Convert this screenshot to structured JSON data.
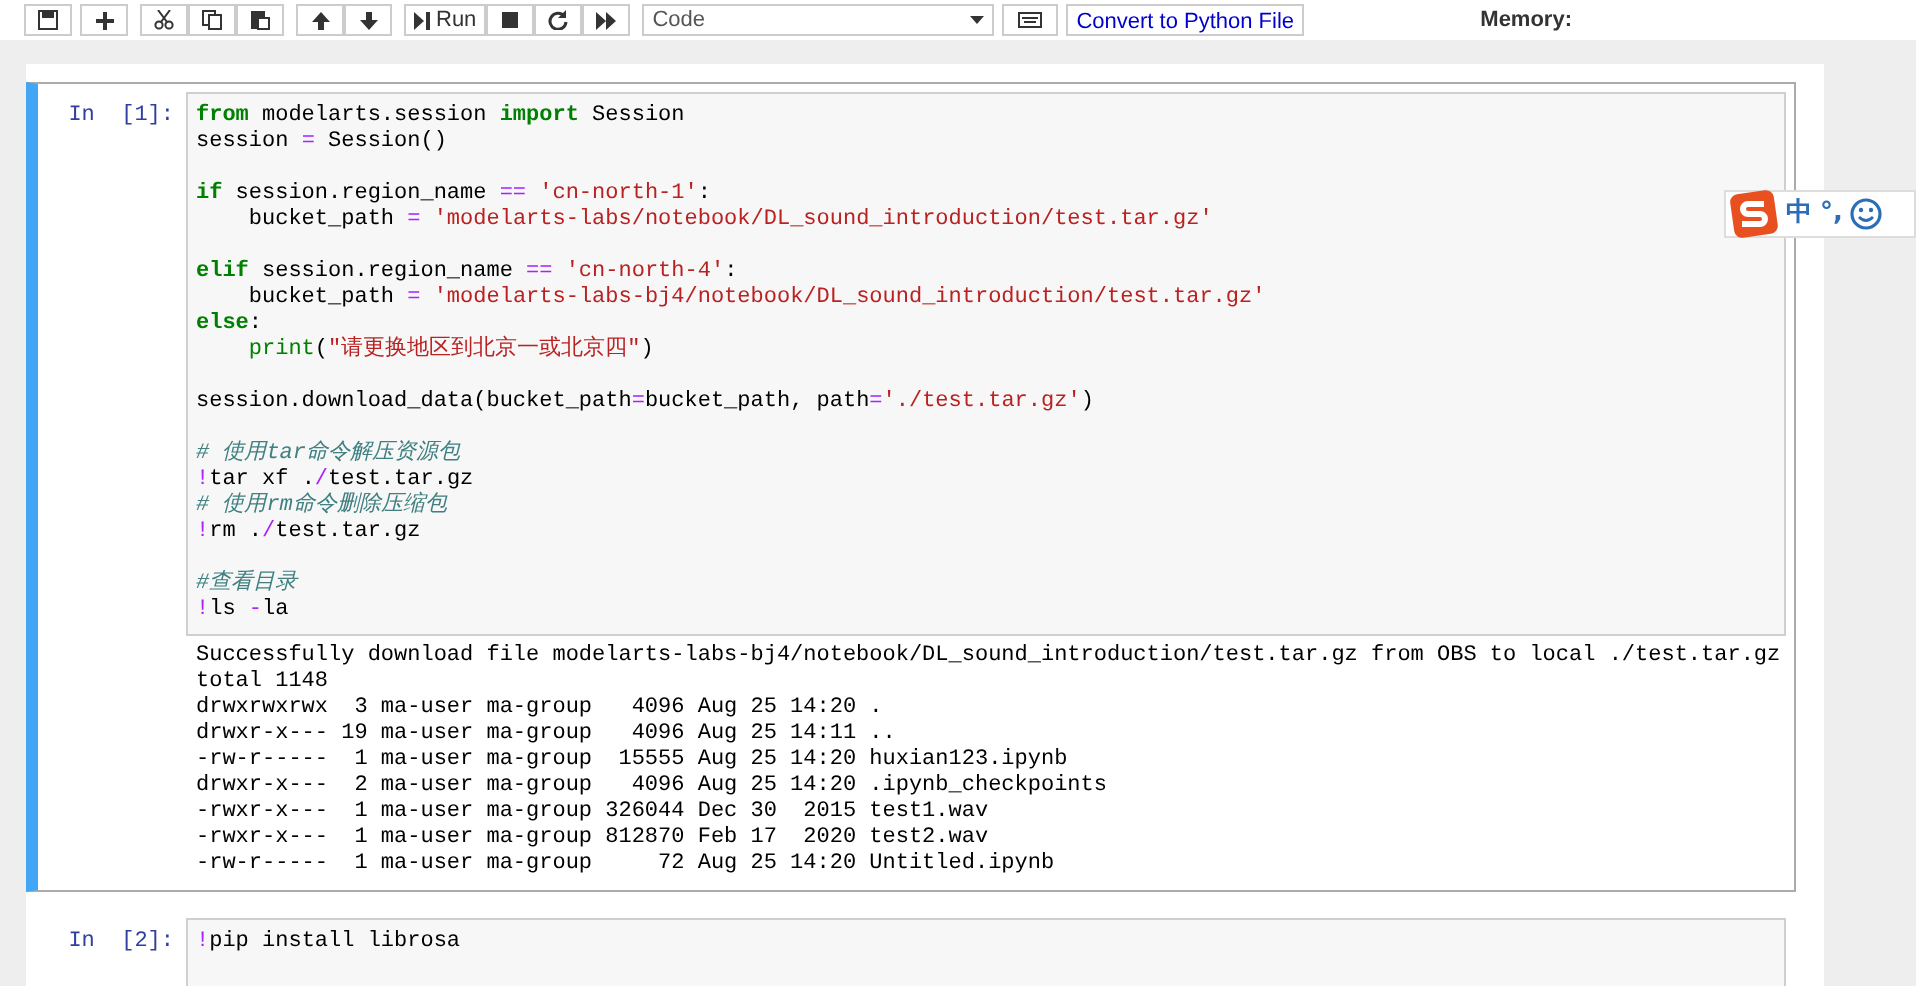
{
  "toolbar": {
    "run_label": "Run",
    "cell_type": "Code",
    "convert_label": "Convert to Python File",
    "memory_label": "Memory:"
  },
  "cells": [
    {
      "prompt": "In [1]:",
      "selected": true,
      "code_blocks": [
        [
          [
            {
              "kind": "kw",
              "text": "from"
            },
            {
              "kind": "plain",
              "text": " modelarts.session "
            },
            {
              "kind": "kw",
              "text": "import"
            },
            {
              "kind": "plain",
              "text": " Session"
            }
          ],
          [
            {
              "kind": "plain",
              "text": "session "
            },
            {
              "kind": "op",
              "text": "="
            },
            {
              "kind": "plain",
              "text": " Session()"
            }
          ]
        ],
        [
          [
            {
              "kind": "kw",
              "text": "if"
            },
            {
              "kind": "plain",
              "text": " session.region_name "
            },
            {
              "kind": "op",
              "text": "=="
            },
            {
              "kind": "str",
              "text": " 'cn-north-1'"
            },
            {
              "kind": "plain",
              "text": ":"
            }
          ],
          [
            {
              "kind": "plain",
              "text": "    bucket_path "
            },
            {
              "kind": "op",
              "text": "="
            },
            {
              "kind": "str",
              "text": " 'modelarts-labs/notebook/DL_sound_introduction/test.tar.gz'"
            }
          ]
        ],
        [
          [
            {
              "kind": "kw",
              "text": "elif"
            },
            {
              "kind": "plain",
              "text": " session.region_name "
            },
            {
              "kind": "op",
              "text": "=="
            },
            {
              "kind": "str",
              "text": " 'cn-north-4'"
            },
            {
              "kind": "plain",
              "text": ":"
            }
          ],
          [
            {
              "kind": "plain",
              "text": "    bucket_path "
            },
            {
              "kind": "op",
              "text": "="
            },
            {
              "kind": "str",
              "text": " 'modelarts-labs-bj4/notebook/DL_sound_introduction/test.tar.gz'"
            }
          ],
          [
            {
              "kind": "kw",
              "text": "else"
            },
            {
              "kind": "plain",
              "text": ":"
            }
          ],
          [
            {
              "kind": "builtin",
              "text": "    print"
            },
            {
              "kind": "plain",
              "text": "("
            },
            {
              "kind": "str",
              "text": "\"请更换地区到北京一或北京四\""
            },
            {
              "kind": "plain",
              "text": ")"
            }
          ]
        ],
        [
          [
            {
              "kind": "plain",
              "text": "session.download_data(bucket_path"
            },
            {
              "kind": "op",
              "text": "="
            },
            {
              "kind": "plain",
              "text": "bucket_path, path"
            },
            {
              "kind": "op",
              "text": "="
            },
            {
              "kind": "str",
              "text": "'./test.tar.gz'"
            },
            {
              "kind": "plain",
              "text": ")"
            }
          ]
        ],
        [
          [
            {
              "kind": "comment",
              "text": "# 使用tar命令解压资源包"
            }
          ],
          [
            {
              "kind": "op",
              "text": "!"
            },
            {
              "kind": "plain",
              "text": "tar xf ."
            },
            {
              "kind": "op",
              "text": "/"
            },
            {
              "kind": "plain",
              "text": "test.tar.gz"
            }
          ],
          [
            {
              "kind": "comment",
              "text": "# 使用rm命令删除压缩包"
            }
          ],
          [
            {
              "kind": "op",
              "text": "!"
            },
            {
              "kind": "plain",
              "text": "rm ."
            },
            {
              "kind": "op",
              "text": "/"
            },
            {
              "kind": "plain",
              "text": "test.tar.gz"
            }
          ]
        ],
        [
          [
            {
              "kind": "comment",
              "text": "#查看目录"
            }
          ],
          [
            {
              "kind": "op",
              "text": "!"
            },
            {
              "kind": "plain",
              "text": "ls "
            },
            {
              "kind": "op",
              "text": "-"
            },
            {
              "kind": "plain",
              "text": "la"
            }
          ]
        ]
      ],
      "output": [
        "Successfully download file modelarts-labs-bj4/notebook/DL_sound_introduction/test.tar.gz from OBS to local ./test.tar.gz",
        "total 1148",
        "drwxrwxrwx  3 ma-user ma-group   4096 Aug 25 14:20 .",
        "drwxr-x--- 19 ma-user ma-group   4096 Aug 25 14:11 ..",
        "-rw-r-----  1 ma-user ma-group  15555 Aug 25 14:20 huxian123.ipynb",
        "drwxr-x---  2 ma-user ma-group   4096 Aug 25 14:20 .ipynb_checkpoints",
        "-rwxr-x---  1 ma-user ma-group 326044 Dec 30  2015 test1.wav",
        "-rwxr-x---  1 ma-user ma-group 812870 Feb 17  2020 test2.wav",
        "-rw-r-----  1 ma-user ma-group     72 Aug 25 14:20 Untitled.ipynb"
      ]
    },
    {
      "prompt": "In [2]:",
      "selected": false,
      "code_blocks": [
        [
          [
            {
              "kind": "op",
              "text": "!"
            },
            {
              "kind": "plain",
              "text": "pip install librosa"
            }
          ]
        ]
      ]
    }
  ],
  "ime_bar": {
    "mode": "中",
    "punctuation": "°,"
  }
}
